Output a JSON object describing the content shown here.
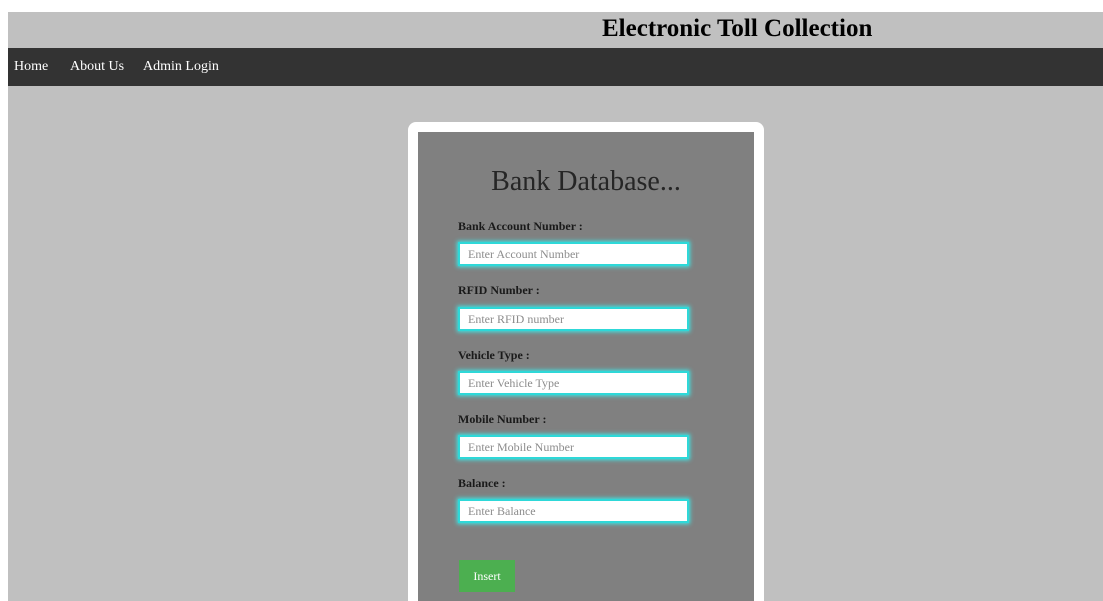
{
  "header": {
    "title": "Electronic Toll Collection"
  },
  "nav": {
    "home": "Home",
    "about": "About Us",
    "admin_login": "Admin Login"
  },
  "form": {
    "title": "Bank Database...",
    "fields": [
      {
        "label": "Bank Account Number :",
        "placeholder": "Enter Account Number",
        "value": ""
      },
      {
        "label": "RFID Number :",
        "placeholder": "Enter RFID number",
        "value": ""
      },
      {
        "label": "Vehicle Type :",
        "placeholder": "Enter Vehicle Type",
        "value": ""
      },
      {
        "label": "Mobile Number :",
        "placeholder": "Enter Mobile Number",
        "value": ""
      },
      {
        "label": "Balance :",
        "placeholder": "Enter Balance",
        "value": ""
      }
    ],
    "submit_label": "Insert"
  },
  "colors": {
    "page_bg": "#c0c0c0",
    "navbar_bg": "#333333",
    "card_bg": "#808080",
    "input_glow": "#3fe6e6",
    "button_bg": "#4caf50"
  }
}
